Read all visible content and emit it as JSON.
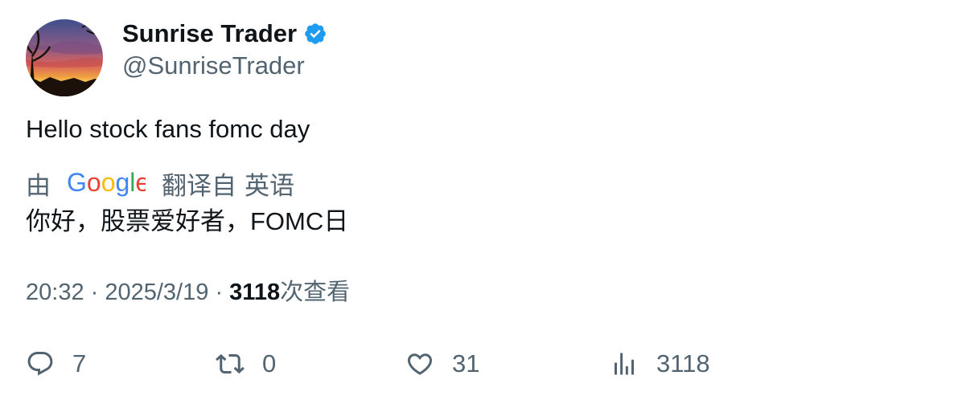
{
  "author": {
    "display_name": "Sunrise Trader",
    "handle": "@SunriseTrader",
    "verified": true,
    "verified_color": "#1d9bf0"
  },
  "tweet": {
    "text": "Hello stock fans fomc day"
  },
  "translation": {
    "by_label": "由",
    "provider": "Google",
    "translated_from_label": "翻译自",
    "source_language": "英语",
    "text": "你好，股票爱好者，FOMC日"
  },
  "meta": {
    "time": "20:32",
    "separator": "·",
    "date": "2025/3/19",
    "views_count": "3118",
    "views_label": "次查看"
  },
  "actions": {
    "reply_count": "7",
    "retweet_count": "0",
    "like_count": "31",
    "views_count": "3118"
  }
}
